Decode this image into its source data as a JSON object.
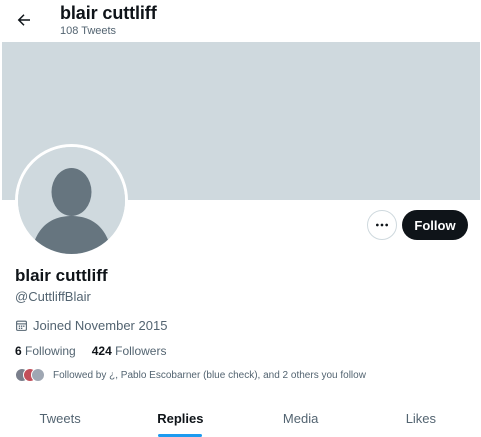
{
  "header": {
    "back_icon": "arrow-left-icon",
    "name": "blair cuttliff",
    "tweet_count": "108 Tweets"
  },
  "profile": {
    "display_name": "blair cuttliff",
    "handle": "@CuttliffBlair",
    "joined": "Joined November 2015",
    "calendar_icon": "calendar-icon",
    "following_count": "6",
    "following_label": "Following",
    "followers_count": "424",
    "followers_label": "Followers",
    "followed_by": "Followed by ¿, Pablo Escobarner (blue check), and 2 others you follow"
  },
  "actions": {
    "more_icon": "more-horizontal-icon",
    "follow_label": "Follow"
  },
  "tabs": [
    {
      "label": "Tweets",
      "active": false
    },
    {
      "label": "Replies",
      "active": true
    },
    {
      "label": "Media",
      "active": false
    },
    {
      "label": "Likes",
      "active": false
    }
  ],
  "colors": {
    "banner": "#cfd9de",
    "accent": "#1d9bf0",
    "follow_button": "#0f1419",
    "secondary_text": "#536471"
  }
}
